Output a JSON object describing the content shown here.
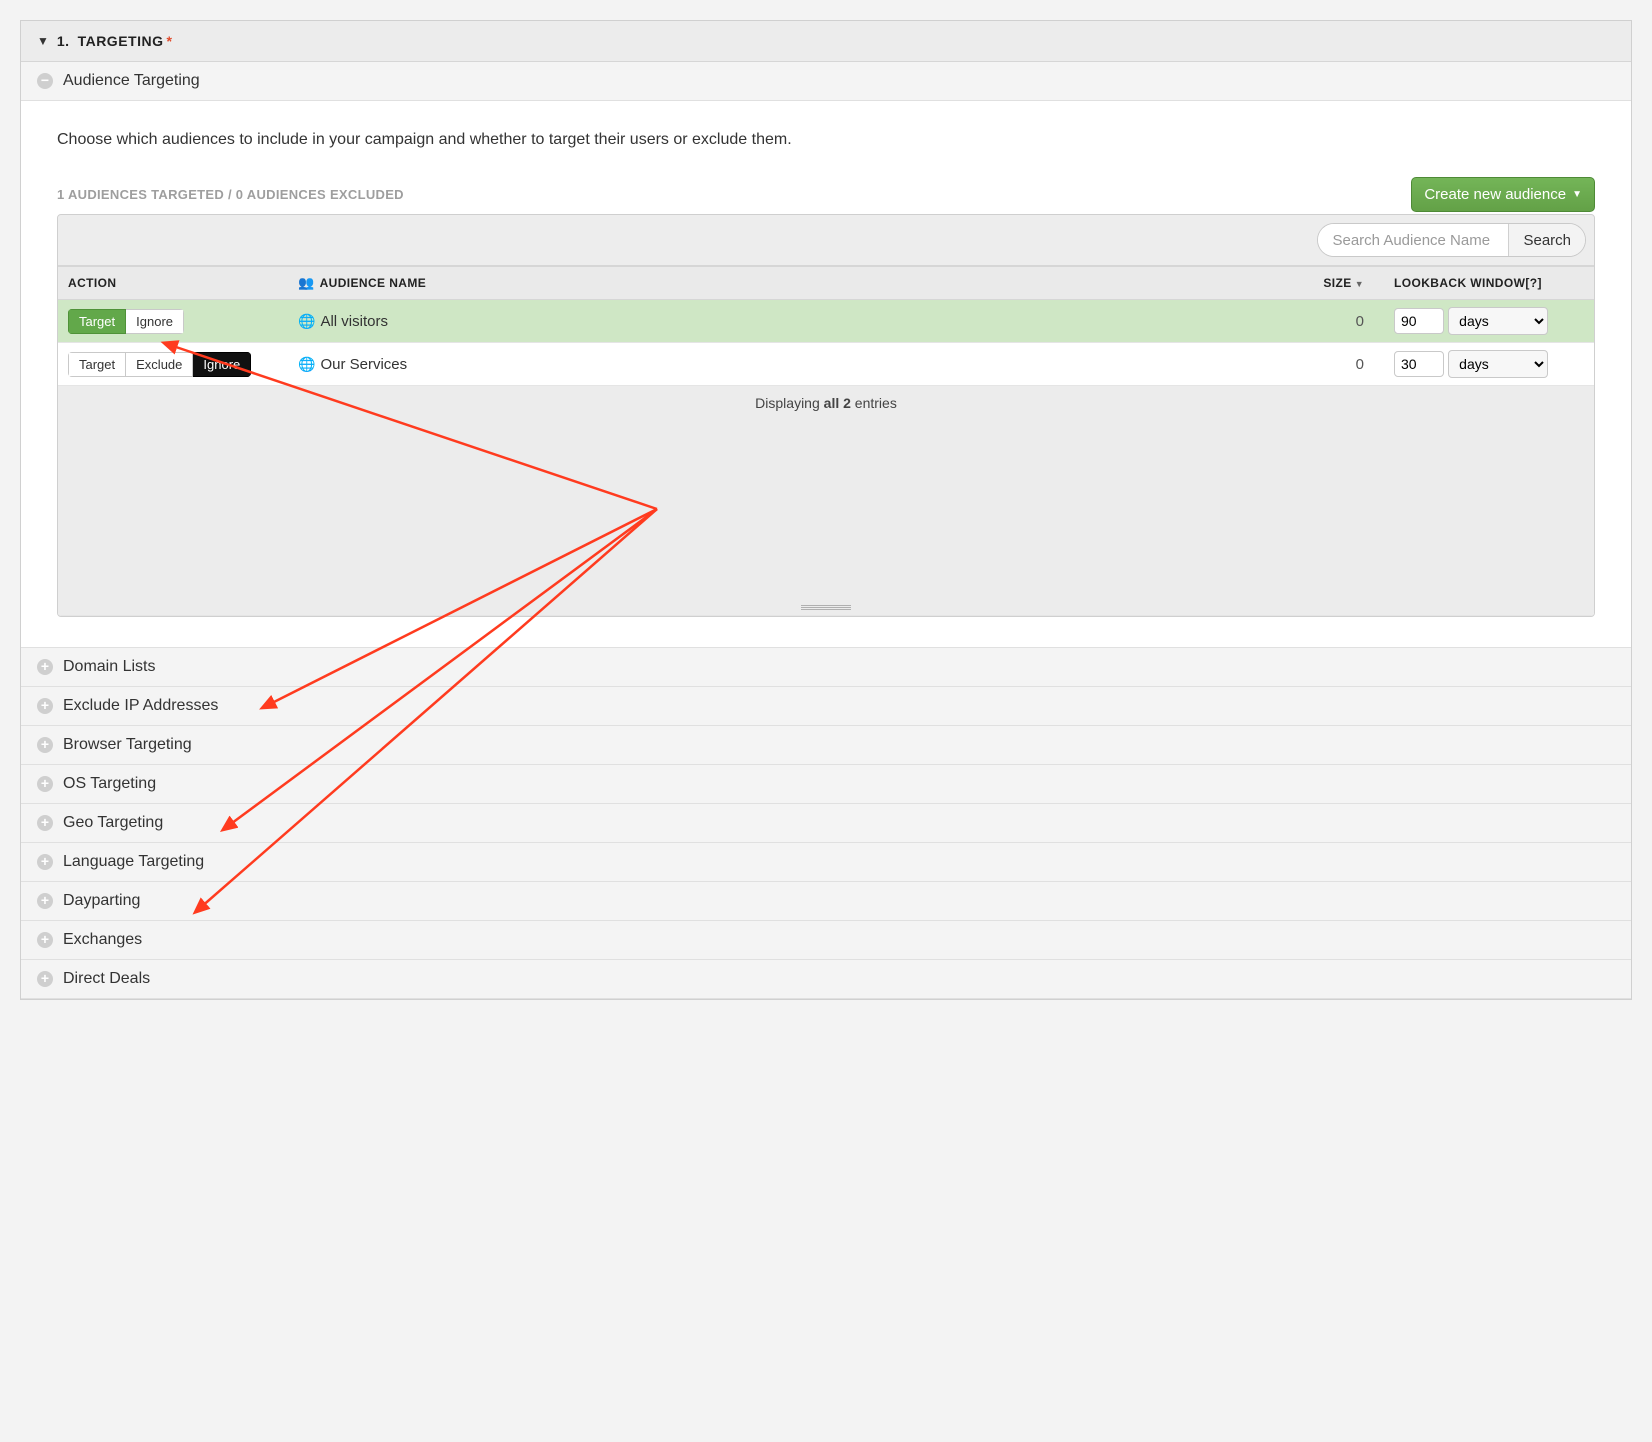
{
  "header": {
    "number": "1.",
    "title": "TARGETING"
  },
  "subheader": {
    "title": "Audience Targeting"
  },
  "description": "Choose which audiences to include in your campaign and whether to target their users or exclude them.",
  "counts_label": "1 AUDIENCES TARGETED / 0 AUDIENCES EXCLUDED",
  "create_button": "Create new audience",
  "search": {
    "placeholder": "Search Audience Name",
    "button": "Search"
  },
  "table": {
    "headers": {
      "action": "ACTION",
      "audience": "AUDIENCE NAME",
      "size": "SIZE",
      "lookback": "LOOKBACK WINDOW[?]"
    },
    "rows": [
      {
        "targeted": true,
        "btn1": "Target",
        "btn2": "Ignore",
        "btn3": "",
        "name": "All visitors",
        "size": "0",
        "lookback_value": "90",
        "lookback_unit": "days"
      },
      {
        "targeted": false,
        "btn1": "Target",
        "btn2": "Exclude",
        "btn3": "Ignore",
        "name": "Our Services",
        "size": "0",
        "lookback_value": "30",
        "lookback_unit": "days"
      }
    ],
    "footer_prefix": "Displaying ",
    "footer_bold": "all 2",
    "footer_suffix": " entries"
  },
  "collapsed_sections": [
    "Domain Lists",
    "Exclude IP Addresses",
    "Browser Targeting",
    "OS Targeting",
    "Geo Targeting",
    "Language Targeting",
    "Dayparting",
    "Exchanges",
    "Direct Deals"
  ]
}
